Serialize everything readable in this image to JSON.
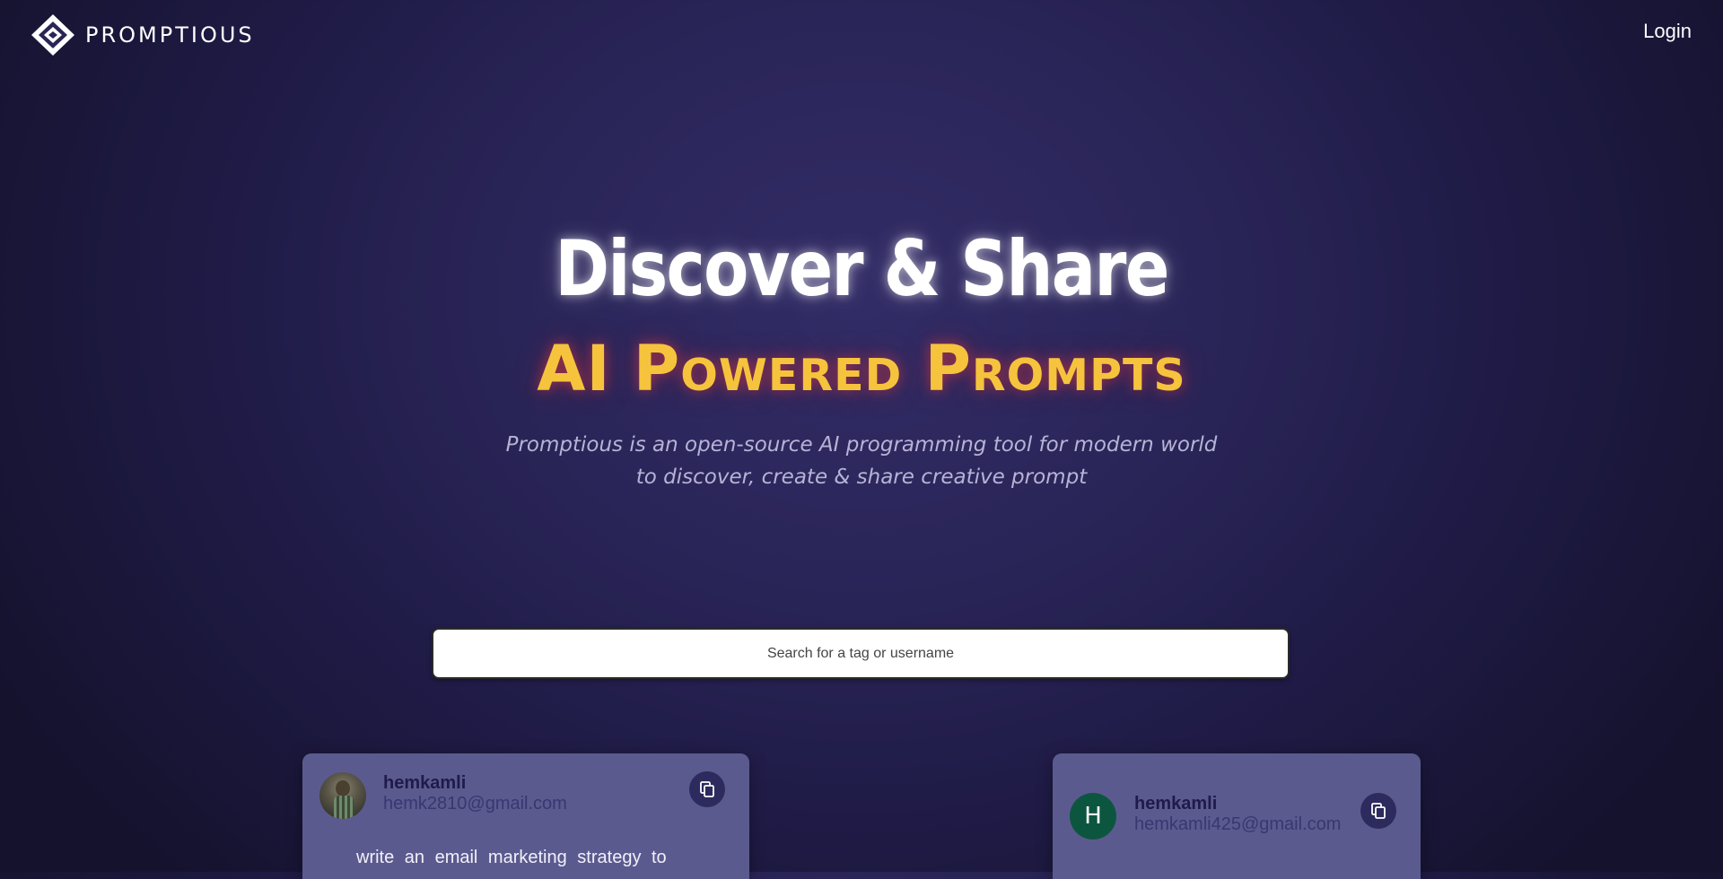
{
  "header": {
    "logo_text": "PROMPTIOUS",
    "logo_icon": "diamond-logo-icon",
    "login_label": "Login"
  },
  "hero": {
    "title": "Discover & Share",
    "subtitle": "AI Powered Prompts",
    "description": "Promptious is an open-source AI programming tool for modern world to discover, create & share creative prompt"
  },
  "search": {
    "placeholder": "Search for a tag or username",
    "value": ""
  },
  "cards": [
    {
      "username": "hemkamli",
      "email": "hemk2810@gmail.com",
      "avatar": "photo",
      "copy_icon": "copy-icon",
      "prompt": "write an email marketing strategy to"
    },
    {
      "username": "hemkamli",
      "email": "hemkamli425@gmail.com",
      "avatar_letter": "H",
      "copy_icon": "copy-icon"
    }
  ],
  "colors": {
    "accent_yellow": "#f6c33d",
    "card_bg": "#5b5a8f",
    "avatar_green": "#0c5640",
    "copy_button_bg": "#2d2a5e"
  }
}
